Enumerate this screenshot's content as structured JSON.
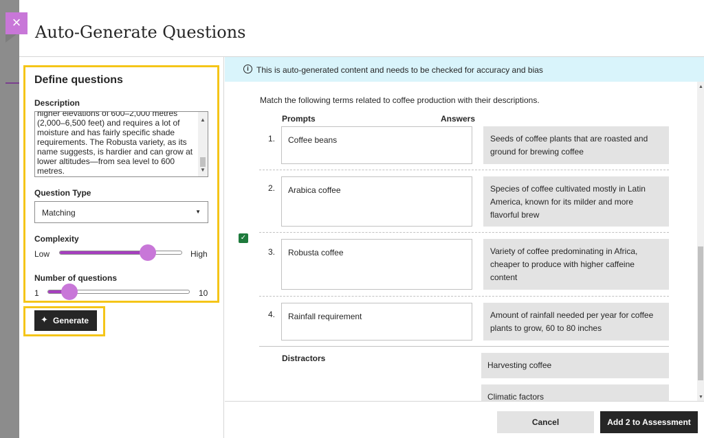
{
  "dialog": {
    "title": "Auto-Generate Questions",
    "close_glyph": "×"
  },
  "define": {
    "heading": "Define questions",
    "description_label": "Description",
    "description_text": "higher elevations of 600–2,000 metres (2,000–6,500 feet) and requires a lot of moisture and has fairly specific shade requirements. The Robusta variety, as its name suggests, is hardier and can grow at lower altitudes—from sea level to 600 metres.",
    "question_type_label": "Question Type",
    "question_type_value": "Matching",
    "complexity_label": "Complexity",
    "complexity_low": "Low",
    "complexity_high": "High",
    "complexity_level": 0.72,
    "num_label": "Number of questions",
    "num_min": "1",
    "num_max": "10",
    "num_value": 2,
    "generate_label": "Generate"
  },
  "info": {
    "text": "This is auto-generated content and needs to be checked for accuracy and bias"
  },
  "question": {
    "instruction": "Match the following terms related to coffee production with their descriptions.",
    "prompts_header": "Prompts",
    "answers_header": "Answers",
    "pairs": [
      {
        "num": "1.",
        "prompt": "Coffee beans",
        "answer": "Seeds of coffee plants that are roasted and ground for brewing coffee"
      },
      {
        "num": "2.",
        "prompt": "Arabica coffee",
        "answer": "Species of coffee cultivated mostly in Latin America, known for its milder and more flavorful brew"
      },
      {
        "num": "3.",
        "prompt": "Robusta coffee",
        "answer": "Variety of coffee predominating in Africa, cheaper to produce with higher caffeine content"
      },
      {
        "num": "4.",
        "prompt": "Rainfall requirement",
        "answer": "Amount of rainfall needed per year for coffee plants to grow, 60 to 80 inches"
      }
    ],
    "distractors_header": "Distractors",
    "distractors": [
      "Harvesting coffee",
      "Climatic factors"
    ]
  },
  "footer": {
    "cancel_label": "Cancel",
    "add_label": "Add 2 to Assessment"
  },
  "colors": {
    "accent": "#c877d8",
    "slider_fill": "#a63fbf",
    "highlight": "#f5c518",
    "info_bg": "#d9f4fb",
    "check": "#1e7a3c"
  }
}
